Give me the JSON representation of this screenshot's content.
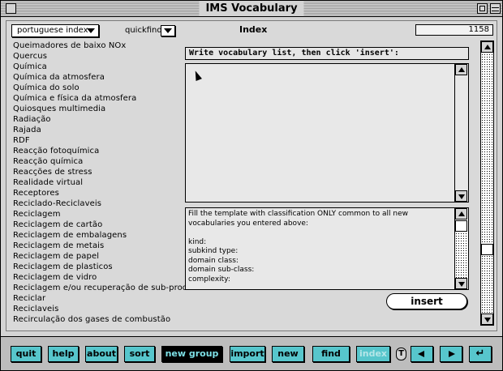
{
  "window": {
    "title": "IMS Vocabulary"
  },
  "header": {
    "index_select": "portuguese index",
    "quickfind_label": "quickfind",
    "heading": "Index",
    "count": "1158"
  },
  "terms": [
    "Queimadores de baixo NOx",
    "Quercus",
    "Química",
    "Química da atmosfera",
    "Química do solo",
    "Química e física da atmosfera",
    "Quiosques multimedia",
    "Radiação",
    "Rajada",
    "RDF",
    "Reacção fotoquímica",
    "Reacção química",
    "Reacções de stress",
    "Realidade virtual",
    "Receptores",
    "Reciclado-Reciclaveis",
    "Reciclagem",
    "Reciclagem de cartão",
    "Reciclagem de embalagens",
    "Reciclagem de metais",
    "Reciclagem de papel",
    "Reciclagem de plasticos",
    "Reciclagem de vidro",
    "Reciclagem e/ou recuperação de sub-produtos",
    "Reciclar",
    "Reciclaveis",
    "Recirculação dos gases de combustão"
  ],
  "editor": {
    "prompt": "Write vocabulary list, then click 'insert':",
    "vocab_text": "",
    "template_text": "Fill the template with classification ONLY common to all new\nvocabularies you entered above:\n\nkind:\nsubkind type:\ndomain class:\ndomain sub-class:\ncomplexity:",
    "insert_label": "insert"
  },
  "toolbar": {
    "quit": "quit",
    "help": "help",
    "about": "about",
    "sort": "sort",
    "new_group": "new group",
    "import": "import",
    "new": "new",
    "find": "find",
    "index": "index",
    "t": "T",
    "enter": "↵"
  },
  "colors": {
    "toolbar_button": "#57c6cc",
    "toolbar_bg": "#bdbdbd",
    "window_bg": "#d4d4d4"
  }
}
